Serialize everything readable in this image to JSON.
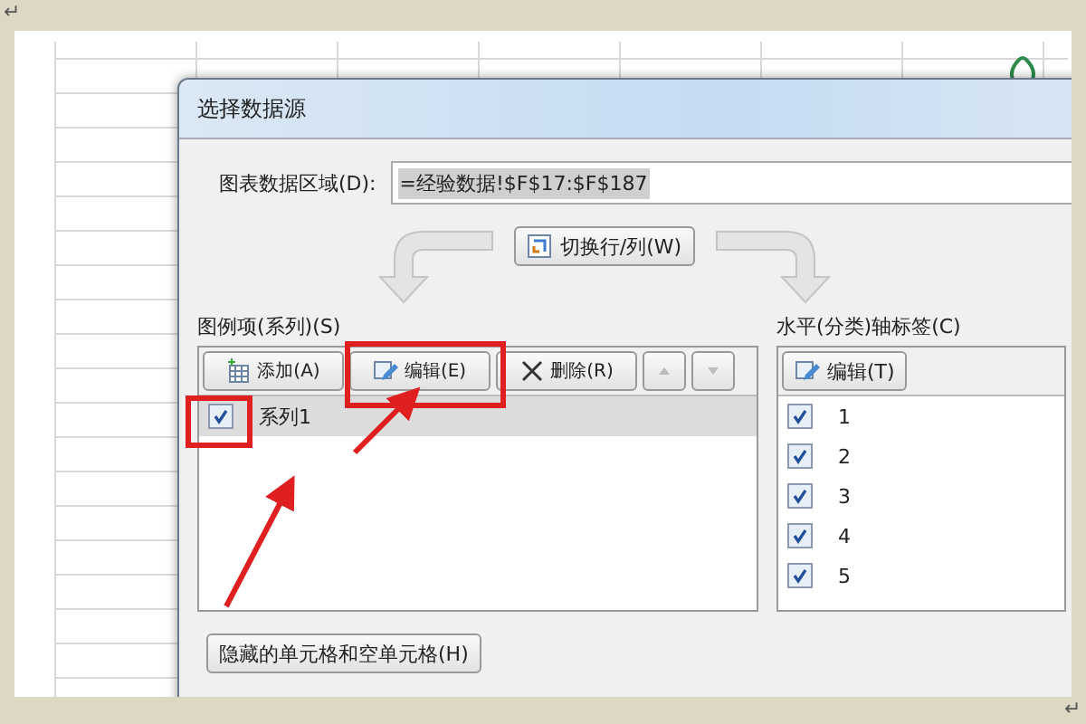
{
  "marks": {
    "top": "↵",
    "bottom": "↵"
  },
  "window": {
    "title": "选择数据源"
  },
  "range": {
    "label": "图表数据区域(D):",
    "value": "=经验数据!$F$17:$F$187"
  },
  "switch_button": "切换行/列(W)",
  "series_panel": {
    "label": "图例项(系列)(S)",
    "toolbar": [
      {
        "kind": "add",
        "label": "添加(A)",
        "disabled": false
      },
      {
        "kind": "edit",
        "label": "编辑(E)",
        "disabled": false
      },
      {
        "kind": "delete",
        "label": "删除(R)",
        "disabled": false
      },
      {
        "kind": "up",
        "disabled": true
      },
      {
        "kind": "down",
        "disabled": true
      }
    ],
    "items": [
      {
        "label": "系列1",
        "checked": true,
        "selected": true
      }
    ]
  },
  "axis_panel": {
    "label": "水平(分类)轴标签(C)",
    "edit_button": "编辑(T)",
    "items": [
      {
        "label": "1",
        "checked": true,
        "selected": false
      },
      {
        "label": "2",
        "checked": true,
        "selected": false
      },
      {
        "label": "3",
        "checked": true,
        "selected": false
      },
      {
        "label": "4",
        "checked": true,
        "selected": false
      },
      {
        "label": "5",
        "checked": true,
        "selected": false
      }
    ]
  },
  "hidden_cells_button": "隐藏的单元格和空单元格(H)"
}
